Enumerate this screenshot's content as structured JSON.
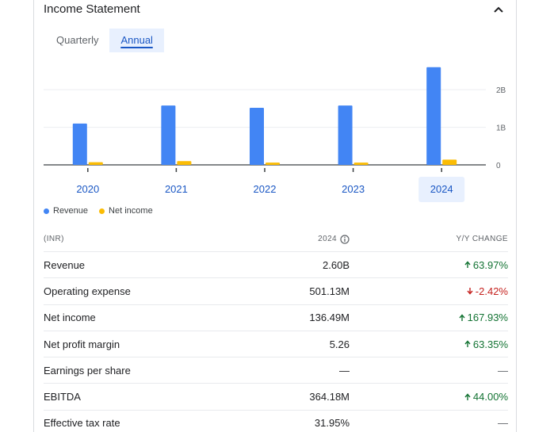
{
  "header": {
    "title": "Income Statement"
  },
  "tabs": [
    {
      "label": "Quarterly",
      "active": false
    },
    {
      "label": "Annual",
      "active": true
    }
  ],
  "colors": {
    "revenue": "#4285f4",
    "net_income": "#fbbc04",
    "accent": "#1a57c4",
    "up": "#137333",
    "down": "#c5221f"
  },
  "chart_data": {
    "type": "bar",
    "categories": [
      "2020",
      "2021",
      "2022",
      "2023",
      "2024"
    ],
    "selected_category": "2024",
    "series": [
      {
        "name": "Revenue",
        "values": [
          1.1,
          1.58,
          1.52,
          1.58,
          2.6
        ]
      },
      {
        "name": "Net income",
        "values": [
          0.07,
          0.1,
          0.06,
          0.06,
          0.14
        ]
      }
    ],
    "y_ticks": [
      {
        "value": 0,
        "label": "0"
      },
      {
        "value": 1,
        "label": "1B"
      },
      {
        "value": 2,
        "label": "2B"
      }
    ],
    "ylim": [
      0,
      2.7
    ],
    "legend_position": "bottom-left",
    "grid": true
  },
  "table": {
    "headers": {
      "label": "(INR)",
      "value": "2024",
      "change": "Y/Y CHANGE"
    },
    "rows": [
      {
        "label": "Revenue",
        "value": "2.60B",
        "change": "63.97%",
        "dir": "up"
      },
      {
        "label": "Operating expense",
        "value": "501.13M",
        "change": "-2.42%",
        "dir": "down"
      },
      {
        "label": "Net income",
        "value": "136.49M",
        "change": "167.93%",
        "dir": "up"
      },
      {
        "label": "Net profit margin",
        "value": "5.26",
        "change": "63.35%",
        "dir": "up"
      },
      {
        "label": "Earnings per share",
        "value": "—",
        "change": "—",
        "dir": "none"
      },
      {
        "label": "EBITDA",
        "value": "364.18M",
        "change": "44.00%",
        "dir": "up"
      },
      {
        "label": "Effective tax rate",
        "value": "31.95%",
        "change": "—",
        "dir": "none"
      }
    ]
  }
}
